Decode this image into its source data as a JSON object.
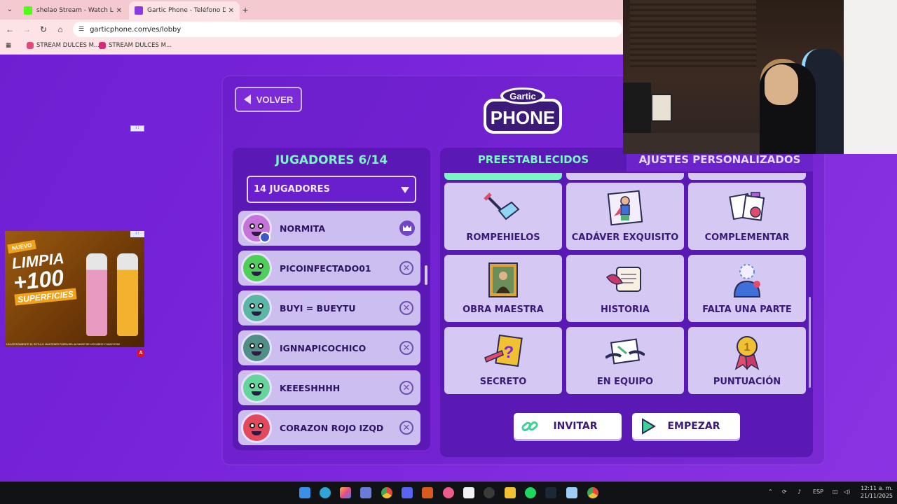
{
  "browser": {
    "tabs": [
      {
        "title": "shelao Stream - Watch Live on",
        "favicon_color": "#53fc18",
        "active": false
      },
      {
        "title": "Gartic Phone - Teléfono Descon",
        "favicon_color": "#8a3be6",
        "active": true
      }
    ],
    "url": "garticphone.com/es/lobby",
    "bookmarks": [
      {
        "label": "STREAM DULCES M...",
        "favicon_color": "#e04a7a"
      },
      {
        "label": "STREAM DULCES M...",
        "favicon_color": "#d62976"
      }
    ]
  },
  "game": {
    "back_label": "VOLVER",
    "logo_line1": "Gartic",
    "logo_line2": "PHONE",
    "players_title": "JUGADORES 6/14",
    "players_select": "14 JUGADORES",
    "players": [
      {
        "name": "NORMITA",
        "avatar_color": "#c574d9",
        "owner": true
      },
      {
        "name": "PICOINFECTADO01",
        "avatar_color": "#4fce5b",
        "owner": false
      },
      {
        "name": "BUYI = BUEYTU",
        "avatar_color": "#5bb6a6",
        "owner": false
      },
      {
        "name": "IGNNAPICOCHICO",
        "avatar_color": "#4f8f86",
        "owner": false
      },
      {
        "name": "KEEESHHHH",
        "avatar_color": "#66d59c",
        "owner": false
      },
      {
        "name": "CORAZON ROJO IZQD",
        "avatar_color": "#e2495a",
        "owner": false
      }
    ],
    "tab_preset": "PREESTABLECIDOS",
    "tab_custom": "AJUSTES PERSONALIZADOS",
    "modes": [
      {
        "name": "ROMPEHIELOS",
        "icon": "ice-pick-icon"
      },
      {
        "name": "CADÁVER EXQUISITO",
        "icon": "superhero-drawing-icon"
      },
      {
        "name": "COMPLEMENTAR",
        "icon": "drawing-cards-icon"
      },
      {
        "name": "OBRA MAESTRA",
        "icon": "mona-lisa-icon"
      },
      {
        "name": "HISTORIA",
        "icon": "scroll-quill-icon"
      },
      {
        "name": "FALTA UNA PARTE",
        "icon": "missing-part-icon"
      },
      {
        "name": "SECRETO",
        "icon": "secret-question-icon"
      },
      {
        "name": "EN EQUIPO",
        "icon": "team-hands-icon"
      },
      {
        "name": "PUNTUACIÓN",
        "icon": "medal-icon"
      }
    ],
    "invite_label": "INVITAR",
    "start_label": "EMPEZAR"
  },
  "ad": {
    "badge": "NUEVO",
    "line1": "LIMPIA",
    "line2": "+100",
    "line3": "SUPERFICIES",
    "fine_print": "LEA ATENTAMENTE EL RÓTULO. MANTENER FUERA DEL ALCANCE DE LOS NIÑOS Y MASCOTAS",
    "corner_label": "A"
  },
  "taskbar": {
    "lang": "ESP",
    "time": "12:11 a. m.",
    "date": "21/11/2025"
  },
  "colors": {
    "page_bg": "#7a22d8",
    "panel_bg": "#5a18b4",
    "accent_green": "#7cf5c5",
    "card_bg": "#d5c8f2"
  }
}
